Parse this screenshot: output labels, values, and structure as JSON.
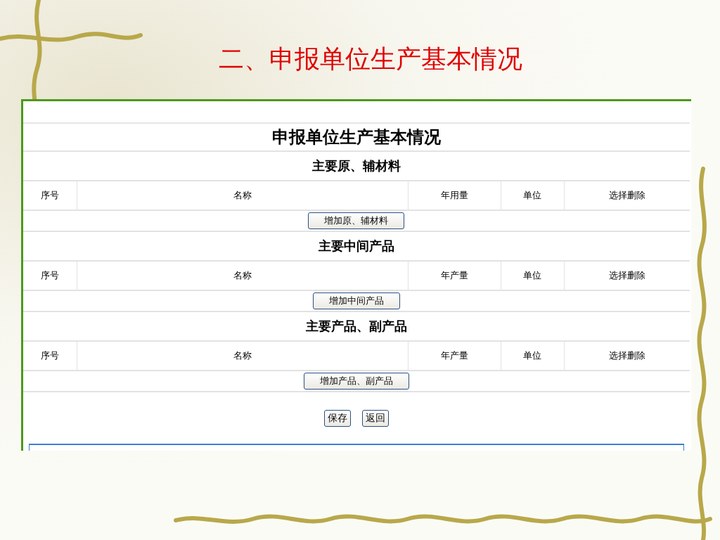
{
  "slide": {
    "title": "二、申报单位生产基本情况"
  },
  "form": {
    "title": "申报单位生产基本情况",
    "sections": [
      {
        "heading": "主要原、辅材料",
        "columns": [
          "序号",
          "名称",
          "年用量",
          "单位",
          "选择删除"
        ],
        "add_button": "增加原、辅材料"
      },
      {
        "heading": "主要中间产品",
        "columns": [
          "序号",
          "名称",
          "年产量",
          "单位",
          "选择删除"
        ],
        "add_button": "增加中间产品"
      },
      {
        "heading": "主要产品、副产品",
        "columns": [
          "序号",
          "名称",
          "年产量",
          "单位",
          "选择删除"
        ],
        "add_button": "增加产品、副产品"
      }
    ],
    "buttons": [
      "保存",
      "返回"
    ]
  }
}
